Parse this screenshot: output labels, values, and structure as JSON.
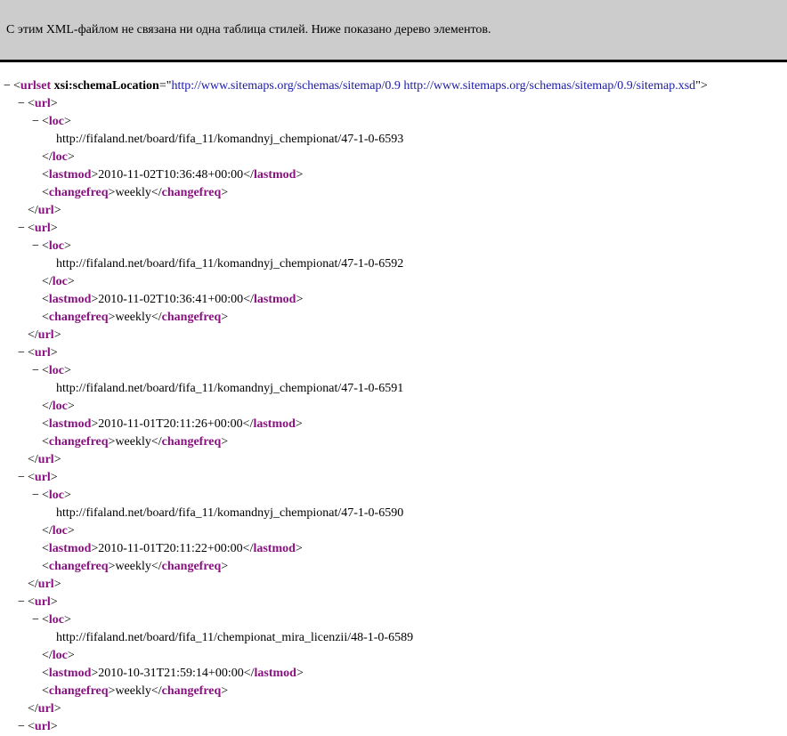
{
  "info_bar": {
    "message": "С этим XML-файлом не связана ни одна таблица стилей. Ниже показано дерево элементов."
  },
  "root": {
    "toggle": "−",
    "tag": "urlset",
    "attr_name": "xsi:schemaLocation",
    "attr_value": "http://www.sitemaps.org/schemas/sitemap/0.9 http://www.sitemaps.org/schemas/sitemap/0.9/sitemap.xsd"
  },
  "tags": {
    "url": "url",
    "loc": "loc",
    "lastmod": "lastmod",
    "changefreq": "changefreq"
  },
  "urls": [
    {
      "loc": "http://fifaland.net/board/fifa_11/komandnyj_chempionat/47-1-0-6593",
      "lastmod": "2010-11-02T10:36:48+00:00",
      "changefreq": "weekly"
    },
    {
      "loc": "http://fifaland.net/board/fifa_11/komandnyj_chempionat/47-1-0-6592",
      "lastmod": "2010-11-02T10:36:41+00:00",
      "changefreq": "weekly"
    },
    {
      "loc": "http://fifaland.net/board/fifa_11/komandnyj_chempionat/47-1-0-6591",
      "lastmod": "2010-11-01T20:11:26+00:00",
      "changefreq": "weekly"
    },
    {
      "loc": "http://fifaland.net/board/fifa_11/komandnyj_chempionat/47-1-0-6590",
      "lastmod": "2010-11-01T20:11:22+00:00",
      "changefreq": "weekly"
    },
    {
      "loc": "http://fifaland.net/board/fifa_11/chempionat_mira_licenzii/48-1-0-6589",
      "lastmod": "2010-10-31T21:59:14+00:00",
      "changefreq": "weekly"
    }
  ],
  "toggle_symbol": "−"
}
